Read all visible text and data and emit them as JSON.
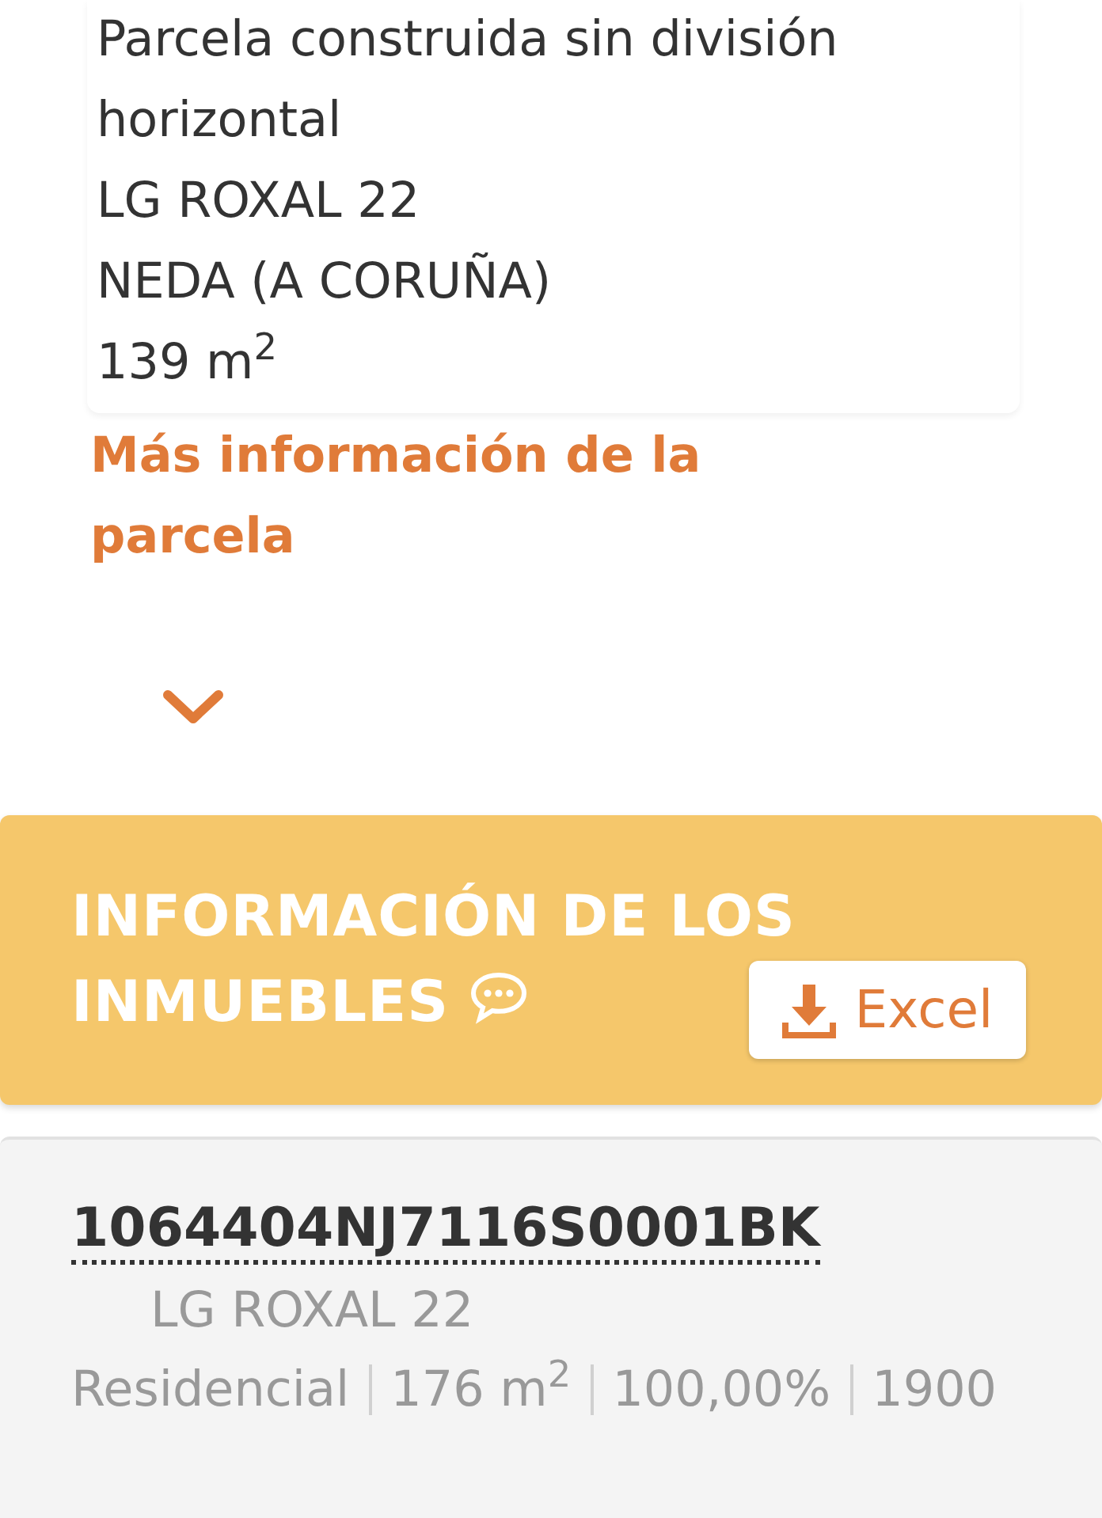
{
  "parcel": {
    "lines": [
      "Parcela construida sin división horizontal",
      "LG ROXAL 22",
      "NEDA (A CORUÑA)",
      "139 m$^{2}$"
    ],
    "more_link": "Más información de la parcela",
    "expanded": false
  },
  "properties_panel": {
    "title": "INFORMACIÓN DE LOS INMUEBLES",
    "export_button": "Excel"
  },
  "properties": [
    {
      "reference": "1064404NJ7116S0001BK",
      "address": "LG ROXAL 22",
      "details": [
        "Residencial",
        "176 m$^{2}$",
        "100,00%",
        "1900"
      ]
    }
  ]
}
